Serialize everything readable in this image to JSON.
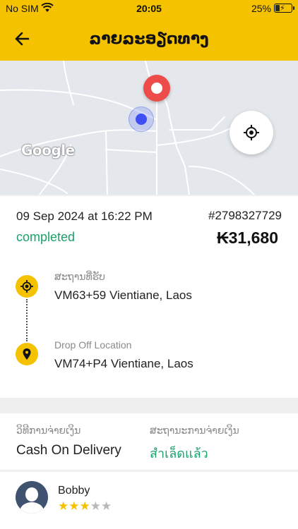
{
  "status_bar": {
    "carrier": "No SIM",
    "time": "20:05",
    "battery_percent": "25%",
    "icons": [
      "wifi-icon",
      "battery-charging-icon"
    ]
  },
  "header": {
    "title": "ລາຍລະອຽດທາງ",
    "back_icon": "arrow-left-icon",
    "background_color": "#f5c200"
  },
  "map": {
    "provider_logo": "Google",
    "locate_icon": "crosshair-icon",
    "pickup_marker_color": "#ee4b4b",
    "current_location_color": "#3d4ef5"
  },
  "trip": {
    "date_time": "09 Sep 2024 at 16:22 PM",
    "order_id": "#2798327729",
    "status": "completed",
    "status_color": "#1aa26a",
    "fare": "₭31,680",
    "pickup": {
      "label": "ສະຖານທີ່ຮັບ",
      "address": "VM63+59 Vientiane, Laos",
      "icon": "target-icon"
    },
    "dropoff": {
      "label": "Drop Off Location",
      "address": "VM74+P4 Vientiane, Laos",
      "icon": "map-pin-icon"
    }
  },
  "payment": {
    "method_label": "ວິທີການຈ່າຍເງິນ",
    "method_value": "Cash On Delivery",
    "status_label": "ສະຖານະການຈ່າຍເງິນ",
    "status_value": "สำเล็ดแล้ว"
  },
  "driver": {
    "name": "Bobby",
    "rating": 3,
    "max_rating": 5,
    "avatar_icon": "user-avatar-icon"
  }
}
